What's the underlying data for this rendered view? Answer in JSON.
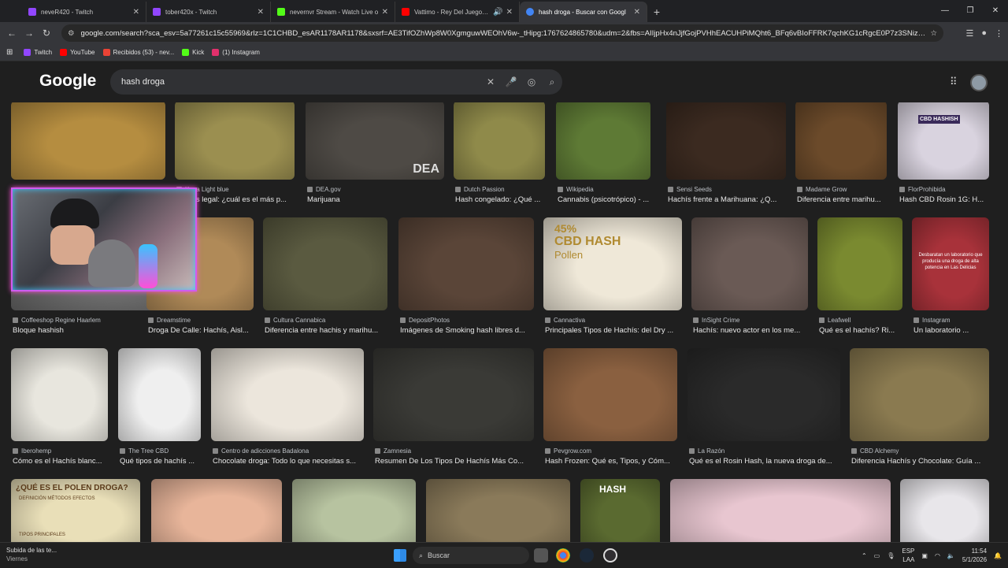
{
  "tabs": [
    {
      "title": "neveR420 - Twitch",
      "favicon_color": "#9146ff"
    },
    {
      "title": "tober420x - Twitch",
      "favicon_color": "#9146ff"
    },
    {
      "title": "nevernvr Stream - Watch Live o",
      "favicon_color": "#53fc18"
    },
    {
      "title": "Vattimo - Rey Del Juego (P",
      "favicon_color": "#ff0000"
    },
    {
      "title": "hash droga - Buscar con Googl",
      "favicon_color": "#4285f4",
      "active": true
    }
  ],
  "toolbar": {
    "url": "google.com/search?sca_esv=5a77261c15c55969&rlz=1C1CHBD_esAR1178AR1178&sxsrf=AE3TifOZhWp8W0XgmguwWEOhV6w-_tHipg:1767624865780&udm=2&fbs=AIIjpHx4nJjfGojPVHhEACUHPiMQht6_BFq6vBIoFFRK7qchKG1cRgcE0P7z3SNizmlu0Qk8Mg..."
  },
  "bookmarks": [
    {
      "label": "Twitch",
      "color": "#9146ff"
    },
    {
      "label": "YouTube",
      "color": "#ff0000"
    },
    {
      "label": "Recibidos (53) - nev...",
      "color": "#ea4335"
    },
    {
      "label": "Kick",
      "color": "#53fc18"
    },
    {
      "label": "(1) Instagram",
      "color": "#e1306c"
    }
  ],
  "google": {
    "logo": "Google",
    "query": "hash droga"
  },
  "results": [
    {
      "source": "",
      "title": "",
      "color": "#b58d40"
    },
    {
      "source": "Kopa Light blue",
      "title": "Hachís legal: ¿cuál es el más p...",
      "color": "#9b8f50"
    },
    {
      "source": "DEA.gov",
      "title": "Marijuana",
      "color": "#4e4a45"
    },
    {
      "source": "Dutch Passion",
      "title": "Hash congelado: ¿Qué ...",
      "color": "#8f8a4a"
    },
    {
      "source": "Wikipedia",
      "title": "Cannabis (psicotrópico) - ...",
      "color": "#5e7a35"
    },
    {
      "source": "Sensi Seeds",
      "title": "Hachís frente a Marihuana: ¿Q...",
      "color": "#3b2a20"
    },
    {
      "source": "Madame Grow",
      "title": "Diferencia entre marihu...",
      "color": "#6b4a2a"
    },
    {
      "source": "FlorProhibida",
      "title": "Hash CBD Rosin 1G: H...",
      "color": "#d9d3df"
    },
    {
      "source": "Coffeeshop Regine Haarlem",
      "title": "Bloque hashish",
      "color": "#6b6b6b"
    },
    {
      "source": "Dreamstime",
      "title": "Droga De Calle: Hachís, Aisl...",
      "color": "#b08a58"
    },
    {
      "source": "Cultura Cannabica",
      "title": "Diferencia entre hachis y marihu...",
      "color": "#5a5a40"
    },
    {
      "source": "DepositPhotos",
      "title": "Imágenes de Smoking hash libres d...",
      "color": "#5a4538"
    },
    {
      "source": "Cannactiva",
      "title": "Principales Tipos de Hachís: del Dry ...",
      "color": "#efe8d8"
    },
    {
      "source": "InSight Crime",
      "title": "Hachís: nuevo actor en los me...",
      "color": "#6a5a55"
    },
    {
      "source": "Leafwell",
      "title": "Qué es el hachís? Ri...",
      "color": "#7a8a30"
    },
    {
      "source": "Instagram",
      "title": "Un laboratorio ...",
      "color": "#a8323a"
    },
    {
      "source": "Iberohemp",
      "title": "Cómo es el Hachís blanc...",
      "color": "#e8e6de"
    },
    {
      "source": "The Tree CBD",
      "title": "Qué tipos de hachís ...",
      "color": "#efefef"
    },
    {
      "source": "Centro de adicciones Badalona",
      "title": "Chocolate droga: Todo lo que necesitas s...",
      "color": "#ece6dc"
    },
    {
      "source": "Zamnesia",
      "title": "Resumen De Los Tipos De Hachís Más Co...",
      "color": "#3a3a36"
    },
    {
      "source": "Pevgrow.com",
      "title": "Hash Frozen: Qué es, Tipos, y Cóm...",
      "color": "#8a6040"
    },
    {
      "source": "La Razón",
      "title": "Qué es el Rosin Hash, la nueva droga de...",
      "color": "#2a2a2a"
    },
    {
      "source": "CBD Alchemy",
      "title": "Diferencia Hachís y Chocolate: Guía ...",
      "color": "#8a7a50"
    },
    {
      "source": "",
      "title": "",
      "color": "#e9dfb8"
    },
    {
      "source": "",
      "title": "",
      "color": "#e8b59a"
    },
    {
      "source": "",
      "title": "",
      "color": "#b7c3a0"
    },
    {
      "source": "",
      "title": "",
      "color": "#8a7a5a"
    },
    {
      "source": "",
      "title": "",
      "color": "#5a6a30"
    },
    {
      "source": "",
      "title": "",
      "color": "#e8c6d0"
    },
    {
      "source": "",
      "title": "",
      "color": "#e8e6ea"
    }
  ],
  "overlay_texts": {
    "dea": "DEA",
    "cbd_pct": "45%",
    "cbd_title": "CBD HASH",
    "cbd_sub": "Pollen",
    "ig_text": "Desbaratan un laboratorio que producía una droga de alta potencia en Las Delicias",
    "polen_title": "¿QUÉ ES EL POLEN DROGA?",
    "polen_cols": "DEFINICIÓN   MÉTODOS   EFECTOS",
    "polen_sub": "TIPOS PRINCIPALES",
    "hash_label": "HASH",
    "cbd_box": "CBD HASHISH"
  },
  "taskbar": {
    "weather": "Subida de las te...",
    "weather_day": "Viernes",
    "search": "Buscar",
    "lang": "ESP",
    "lang2": "LAA",
    "time": "11:54",
    "date": "5/1/2026"
  }
}
